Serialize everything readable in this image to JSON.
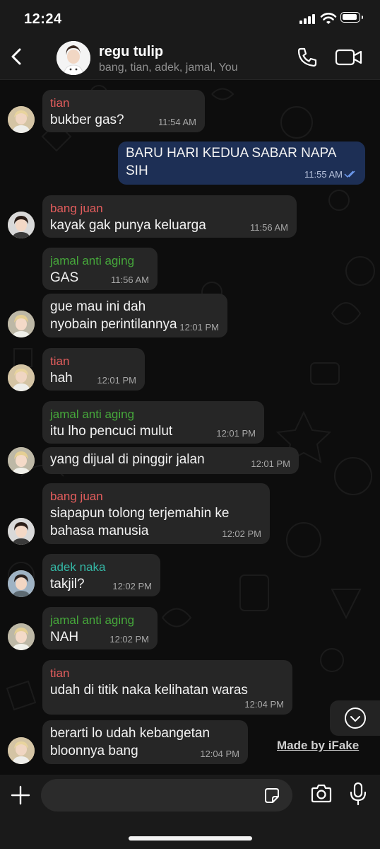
{
  "status_bar": {
    "time": "12:24"
  },
  "header": {
    "group_name": "regu tulip",
    "members": "bang, tian, adek, jamal, You"
  },
  "messages": [
    {
      "sender": "tian",
      "text": "bukber gas?",
      "time": "11:54 AM"
    },
    {
      "text": "BARU HARI KEDUA SABAR NAPA SIH",
      "time": "11:55 AM"
    },
    {
      "sender": "bang juan",
      "text": "kayak gak punya keluarga",
      "time": "11:56 AM"
    },
    {
      "sender": "jamal anti aging",
      "text": "GAS",
      "time": "11:56 AM"
    },
    {
      "text": "gue mau ini dah nyobain perintilannya",
      "time": "12:01 PM"
    },
    {
      "sender": "tian",
      "text": "hah",
      "time": "12:01 PM"
    },
    {
      "sender": "jamal anti aging",
      "text": "itu lho pencuci mulut",
      "time": "12:01 PM"
    },
    {
      "text": "yang dijual di pinggir jalan",
      "time": "12:01 PM"
    },
    {
      "sender": "bang juan",
      "text": "siapapun tolong terjemahin ke bahasa manusia",
      "time": "12:02 PM"
    },
    {
      "sender": "adek naka",
      "text": "takjil?",
      "time": "12:02 PM"
    },
    {
      "sender": "jamal anti aging",
      "text": "NAH",
      "time": "12:02 PM"
    },
    {
      "sender": "tian",
      "text": "udah di titik naka kelihatan waras",
      "time": "12:04 PM"
    },
    {
      "text": "berarti lo udah kebangetan bloonnya bang",
      "time": "12:04 PM"
    }
  ],
  "colors": {
    "tian": "#e35d5d",
    "bang_juan": "#e35d5d",
    "jamal": "#46a83b",
    "adek": "#34b7a5",
    "outgoing_bubble": "#1d2f55",
    "incoming_bubble": "#262626"
  },
  "watermark": "Made by iFake",
  "icons": [
    "back-chevron-icon",
    "phone-icon",
    "video-camera-icon",
    "scroll-down-icon",
    "plus-icon",
    "sticker-icon",
    "camera-icon",
    "microphone-icon"
  ]
}
